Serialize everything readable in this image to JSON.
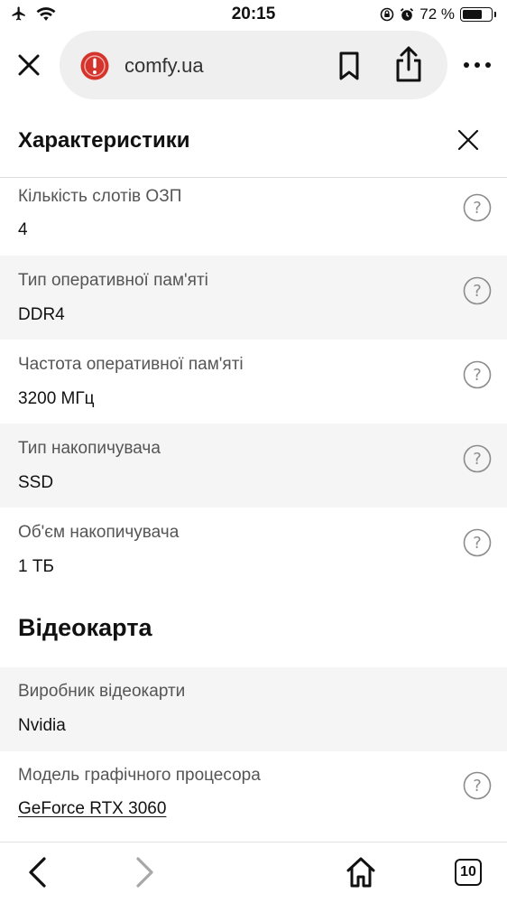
{
  "status_bar": {
    "time": "20:15",
    "battery_percent": "72 %",
    "battery_level": 0.72,
    "icons": [
      "airplane-icon",
      "wifi-icon",
      "orientation-lock-icon",
      "alarm-icon",
      "battery-icon"
    ]
  },
  "browser": {
    "url": "comfy.ua",
    "icons": [
      "close-icon",
      "warning-icon",
      "bookmark-icon",
      "share-icon",
      "more-icon"
    ]
  },
  "panel": {
    "title": "Характеристики"
  },
  "specs": [
    {
      "label": "Кількість слотів ОЗП",
      "value": "4"
    },
    {
      "label": "Тип оперативної пам'яті",
      "value": "DDR4"
    },
    {
      "label": "Частота оперативної пам'яті",
      "value": "3200 МГц"
    },
    {
      "label": "Тип накопичувача",
      "value": "SSD"
    },
    {
      "label": "Об'єм накопичувача",
      "value": "1 ТБ"
    }
  ],
  "gpu_section": {
    "title": "Відеокарта",
    "specs": [
      {
        "label": "Виробник відеокарти",
        "value": "Nvidia"
      },
      {
        "label": "Модель графічного процесора",
        "value": "GeForce RTX 3060"
      }
    ]
  },
  "toolbar": {
    "tab_count": "10",
    "icons": [
      "back-icon",
      "forward-icon",
      "home-icon",
      "tabs-icon"
    ]
  }
}
